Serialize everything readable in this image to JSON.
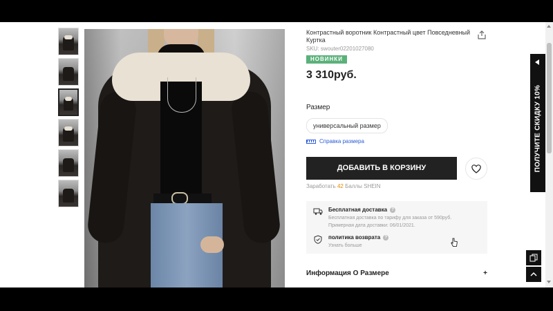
{
  "product": {
    "title": "Контрастный воротник Контрастный цвет Повседневный Куртка",
    "sku": "SKU: swouter02201027080",
    "badge": "НОВИНКИ",
    "price": "3 310руб.",
    "size_label": "Размер",
    "size_option": "универсальный размер",
    "size_guide": "Справка размера",
    "add_to_cart": "ДОБАВИТЬ В КОРЗИНУ",
    "points_prefix": "Заработать",
    "points_value": "42",
    "points_suffix": "Баллы SHEIN"
  },
  "shipping": {
    "free_title": "Бесплатная доставка",
    "free_line1": "Бесплатная доставка по тарифу для заказа от 590руб.",
    "free_line2": "Примерная дата доставки: 06/01/2021.",
    "return_title": "политика возврата",
    "return_link": "Узнать больше"
  },
  "accordion": {
    "size_info": "Информация О Размере",
    "plus": "+"
  },
  "promo": {
    "text": "ПОЛУЧИТЕ СКИДКУ 10%"
  },
  "icons": {
    "share": "share-icon",
    "heart": "heart-icon",
    "truck": "truck-icon",
    "shield": "shield-icon",
    "ruler": "ruler-icon",
    "copy": "copy-icon",
    "back_to_top": "chevron-up-icon"
  },
  "colors": {
    "badge_green": "#5bb17a",
    "button_dark": "#222222",
    "link_blue": "#2a5bd7",
    "points_orange": "#e08a00"
  }
}
